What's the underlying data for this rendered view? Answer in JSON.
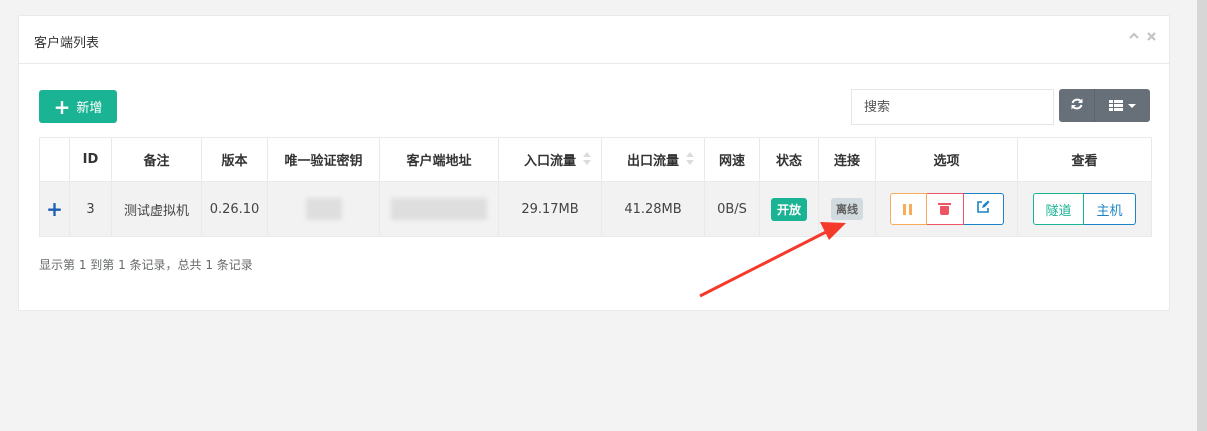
{
  "panel": {
    "title": "客户端列表",
    "collapse_icon": "chevron-up-icon",
    "close_icon": "close-icon"
  },
  "toolbar": {
    "add_label": "新增",
    "search_placeholder": "搜索",
    "refresh_icon": "refresh-icon",
    "columns_icon": "grid-icon"
  },
  "table": {
    "headers": [
      "",
      "ID",
      "备注",
      "版本",
      "唯一验证密钥",
      "客户端地址",
      "入口流量",
      "出口流量",
      "网速",
      "状态",
      "连接",
      "选项",
      "查看"
    ],
    "rows": [
      {
        "expand": "+",
        "id": "3",
        "remark": "测试虚拟机",
        "version": "0.26.10",
        "in_flow": "29.17MB",
        "out_flow": "41.28MB",
        "speed": "0B/S",
        "status": "开放",
        "connection": "离线",
        "view_tunnel": "隧道",
        "view_host": "主机"
      }
    ]
  },
  "footer": {
    "summary": "显示第 1 到第 1 条记录，总共 1 条记录"
  },
  "colors": {
    "primary": "#1ab394",
    "warning": "#f8ac59",
    "danger": "#ed5565",
    "info": "#1c84c6",
    "annotation": "#f5392b"
  }
}
